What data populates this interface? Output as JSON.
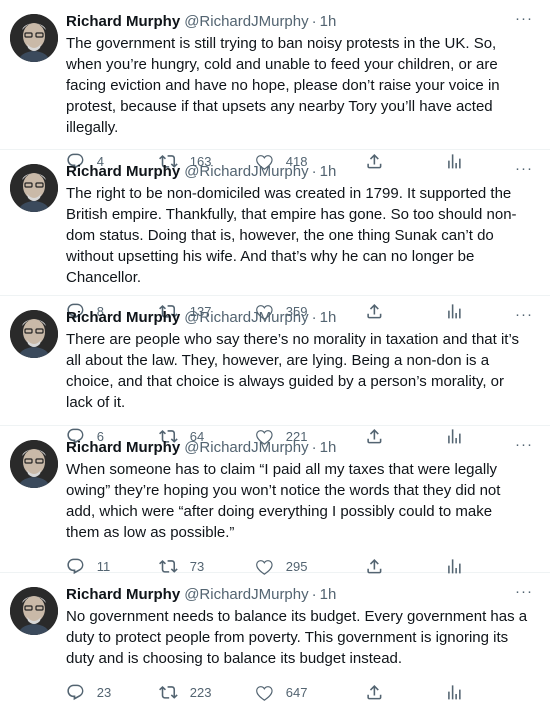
{
  "tweets": [
    {
      "name": "Richard Murphy",
      "handle": "@RichardJMurphy",
      "separator": "·",
      "time": "1h",
      "text": "The government is still trying to ban noisy protests in the UK. So, when you’re hungry, cold and unable to feed your children, or are facing eviction and have no hope, please don’t raise your voice in protest, because if that upsets any nearby Tory you’ll have acted illegally.",
      "replies": "4",
      "retweets": "163",
      "likes": "418"
    },
    {
      "name": "Richard Murphy",
      "handle": "@RichardJMurphy",
      "separator": "·",
      "time": "1h",
      "text": "The right to be non-domiciled was created in 1799. It supported the British empire. Thankfully, that empire has gone. So too should non-dom status. Doing that is, however, the one thing Sunak can’t do without upsetting his wife. And that’s why he can no longer be Chancellor.",
      "replies": "8",
      "retweets": "137",
      "likes": "359"
    },
    {
      "name": "Richard Murphy",
      "handle": "@RichardJMurphy",
      "separator": "·",
      "time": "1h",
      "text": "There are people who say there’s no morality in taxation and that it’s all about the law. They, however, are lying. Being a non-don is a choice, and that choice is always guided by a person’s morality, or lack of it.",
      "replies": "6",
      "retweets": "64",
      "likes": "221"
    },
    {
      "name": "Richard Murphy",
      "handle": "@RichardJMurphy",
      "separator": "·",
      "time": "1h",
      "text": "When someone has to claim “I paid all my taxes that were legally owing” they’re hoping you won’t notice the words that they did not add, which were “after doing everything I possibly could to make them as low as possible.”",
      "replies": "11",
      "retweets": "73",
      "likes": "295"
    },
    {
      "name": "Richard Murphy",
      "handle": "@RichardJMurphy",
      "separator": "·",
      "time": "1h",
      "text": "No government needs to balance its budget. Every government has a duty to protect people from poverty. This government is ignoring its duty and is choosing to balance its budget instead.",
      "replies": "23",
      "retweets": "223",
      "likes": "647"
    }
  ],
  "icons": {
    "more": "more-icon",
    "reply": "reply-icon",
    "retweet": "retweet-icon",
    "like": "heart-icon",
    "share": "share-icon",
    "analytics": "analytics-icon"
  },
  "colors": {
    "text": "#0f1419",
    "secondary": "#536471",
    "divider": "#eff3f4"
  }
}
